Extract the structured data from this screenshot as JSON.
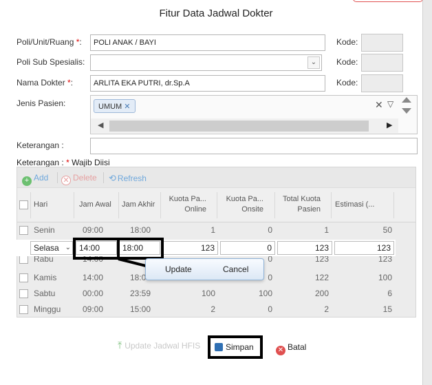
{
  "title": "Fitur Data Jadwal Dokter",
  "form": {
    "poli_label": "Poli/Unit/Ruang ",
    "poli_value": "POLI ANAK / BAYI",
    "subspesialis_label": "Poli Sub Spesialis:",
    "subspesialis_value": "",
    "dokter_label": "Nama Dokter ",
    "dokter_value": "ARLITA EKA PUTRI, dr.Sp.A",
    "jenis_label": "Jenis Pasien:",
    "jenis_tag": "UMUM",
    "keterangan_label": "Keterangan :",
    "keterangan_value": "",
    "kode_label": "Kode:",
    "required_star": "*",
    "colon": ":",
    "note_prefix": "Keterangan : ",
    "note_suffix": " Wajib Diisi"
  },
  "toolbar": {
    "add": "Add",
    "delete": "Delete",
    "refresh": "Refresh"
  },
  "columns": {
    "hari": "Hari",
    "jam_awal": "Jam Awal",
    "jam_akhir": "Jam Akhir",
    "kuota_online": [
      "Kuota Pa...",
      "Online"
    ],
    "kuota_onsite": [
      "Kuota Pa...",
      "Onsite"
    ],
    "total_kuota": [
      "Total Kuota",
      "Pasien"
    ],
    "estimasi": "Estimasi (..."
  },
  "rows": [
    {
      "hari": "Senin",
      "awal": "09:00",
      "akhir": "18:00",
      "online": "1",
      "onsite": "0",
      "total": "1",
      "est": "50"
    },
    {
      "hari": "Rabu",
      "awal": "14:00",
      "akhir": "",
      "online": "",
      "onsite": "0",
      "total": "123",
      "est": "123"
    },
    {
      "hari": "Kamis",
      "awal": "14:00",
      "akhir": "18:0",
      "online": "",
      "onsite": "0",
      "total": "122",
      "est": "100"
    },
    {
      "hari": "Sabtu",
      "awal": "00:00",
      "akhir": "23:59",
      "online": "100",
      "onsite": "100",
      "total": "200",
      "est": "6"
    },
    {
      "hari": "Minggu",
      "awal": "09:00",
      "akhir": "15:00",
      "online": "2",
      "onsite": "0",
      "total": "2",
      "est": "15"
    }
  ],
  "edit_row": {
    "hari": "Selasa",
    "awal": "14:00",
    "akhir": "18:00",
    "online": "123",
    "onsite": "0",
    "total": "123",
    "est": "123"
  },
  "popup": {
    "update": "Update",
    "cancel": "Cancel"
  },
  "buttons": {
    "hfis": "Update Jadwal HFIS",
    "simpan": "Simpan",
    "batal": "Batal"
  },
  "colors": {
    "accent": "#6fa8dc",
    "danger": "#e05050",
    "highlight": "#000000"
  }
}
